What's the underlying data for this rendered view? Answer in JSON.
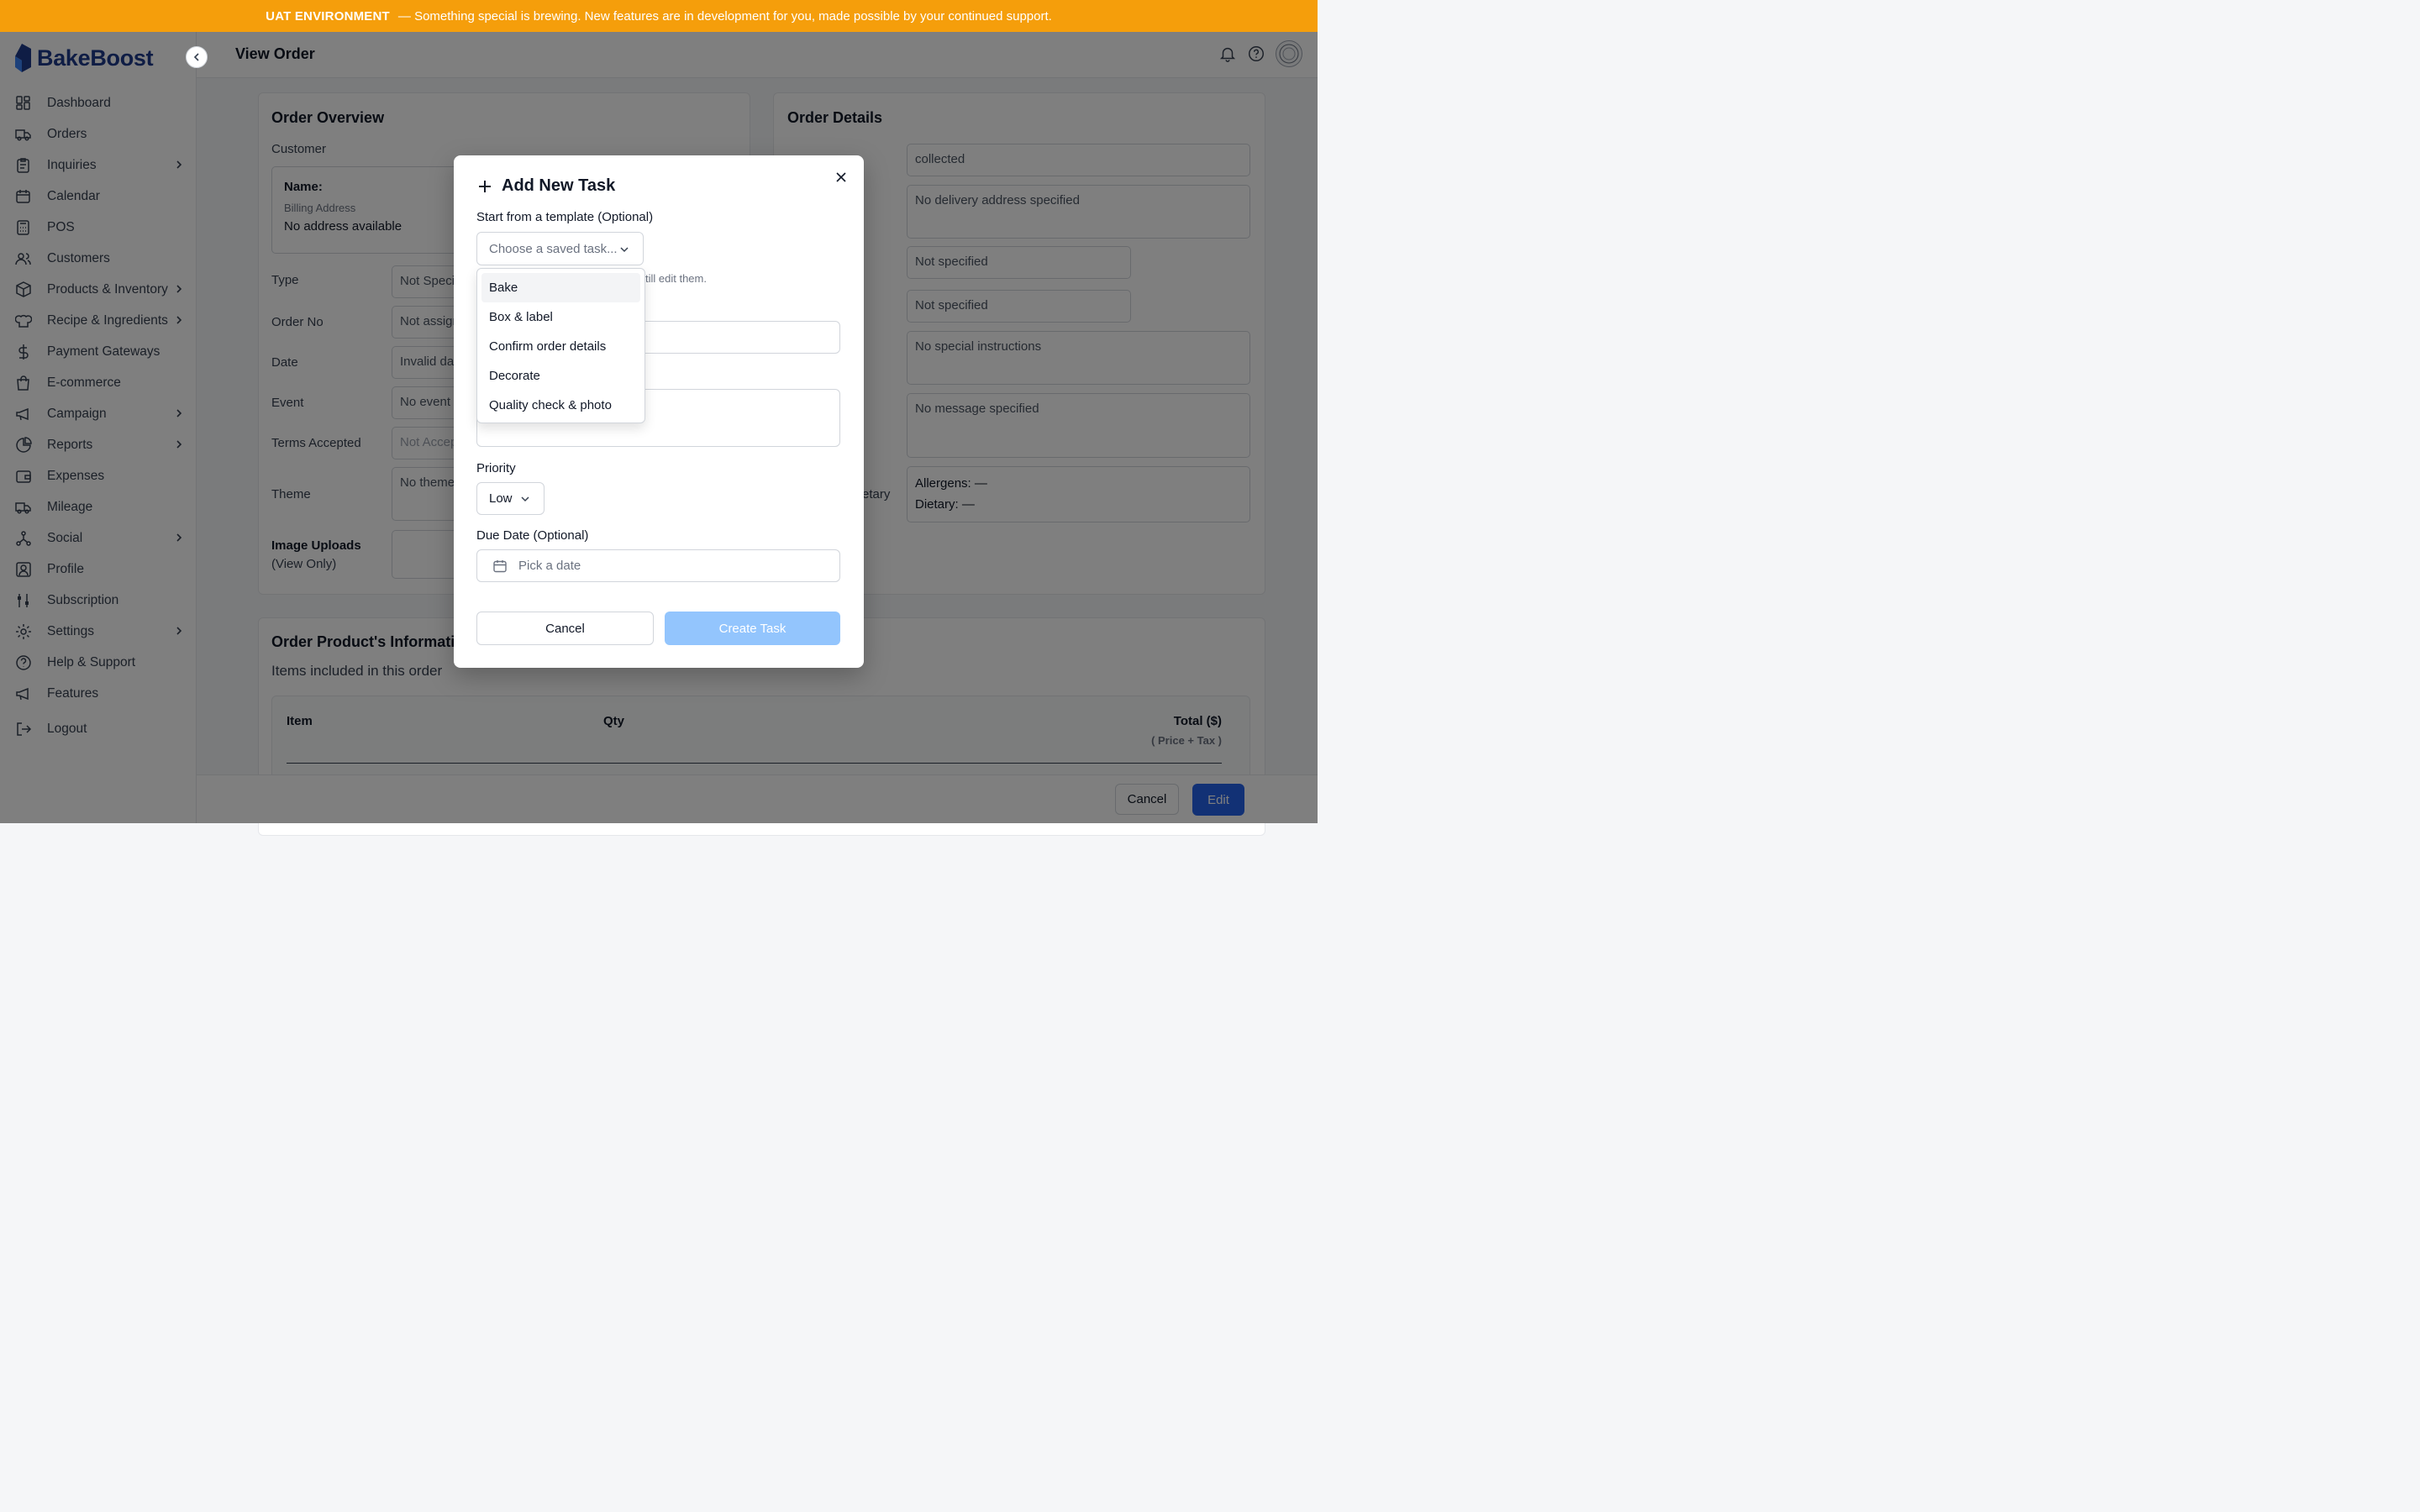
{
  "banner": {
    "env": "UAT ENVIRONMENT",
    "message": "— Something special is brewing. New features are in development for you, made possible by your continued support."
  },
  "brand": {
    "name": "BakeBoost"
  },
  "sidebar": {
    "items": [
      {
        "label": "Dashboard",
        "icon": "dashboard-icon"
      },
      {
        "label": "Orders",
        "icon": "truck-icon"
      },
      {
        "label": "Inquiries",
        "icon": "clipboard-icon",
        "has_children": true
      },
      {
        "label": "Calendar",
        "icon": "calendar-icon"
      },
      {
        "label": "POS",
        "icon": "calculator-icon"
      },
      {
        "label": "Customers",
        "icon": "users-icon"
      },
      {
        "label": "Products & Inventory",
        "icon": "box-icon",
        "has_children": true
      },
      {
        "label": "Recipe & Ingredients",
        "icon": "chef-hat-icon",
        "has_children": true
      },
      {
        "label": "Payment Gateways",
        "icon": "dollar-icon"
      },
      {
        "label": "E-commerce",
        "icon": "shopping-bag-icon"
      },
      {
        "label": "Campaign",
        "icon": "megaphone-icon",
        "has_children": true
      },
      {
        "label": "Reports",
        "icon": "pie-chart-icon",
        "has_children": true
      },
      {
        "label": "Expenses",
        "icon": "wallet-icon"
      },
      {
        "label": "Mileage",
        "icon": "truck-icon"
      },
      {
        "label": "Social",
        "icon": "share-icon",
        "has_children": true
      },
      {
        "label": "Profile",
        "icon": "user-square-icon"
      },
      {
        "label": "Subscription",
        "icon": "sliders-icon"
      },
      {
        "label": "Settings",
        "icon": "gear-icon",
        "has_children": true
      },
      {
        "label": "Help & Support",
        "icon": "help-circle-icon"
      },
      {
        "label": "Features",
        "icon": "megaphone-icon"
      },
      {
        "label": "Logout",
        "icon": "logout-icon"
      }
    ]
  },
  "header": {
    "title": "View Order"
  },
  "overview": {
    "title": "Order Overview",
    "customer_label": "Customer",
    "name_label": "Name:",
    "billing_label": "Billing Address",
    "billing_value": "No address available",
    "type_label": "Type",
    "type_value": "Not Speci",
    "order_no_label": "Order No",
    "order_no_value": "Not assign",
    "date_label": "Date",
    "date_value": "Invalid dat",
    "event_label": "Event",
    "event_value": "No event s",
    "terms_label": "Terms Accepted",
    "terms_value": "Not Accep",
    "theme_label": "Theme",
    "theme_value": "No theme",
    "images_label": "Image Uploads",
    "images_sub": "(View Only)"
  },
  "details": {
    "title": "Order Details",
    "status_value": "collected",
    "delivery_value": "No delivery address specified",
    "field3_value": "Not specified",
    "field4_value": "Not specified",
    "instructions_value": "No special instructions",
    "message_value": "No message specified",
    "dietary_label_partial": "etary",
    "allergens": "Allergens: —",
    "dietary": "Dietary: —"
  },
  "products": {
    "title": "Order Product's Informatior",
    "subtitle": "Items included in this order",
    "col_item": "Item",
    "col_qty": "Qty",
    "col_total": "Total ($)",
    "col_total_sub": "( Price + Tax )"
  },
  "footer": {
    "cancel": "Cancel",
    "edit": "Edit"
  },
  "modal": {
    "title": "Add New Task",
    "template_label": "Start from a template (Optional)",
    "template_placeholder": "Choose a saved task...",
    "hint_partial": "till edit them.",
    "priority_label": "Priority",
    "priority_value": "Low",
    "due_label": "Due Date (Optional)",
    "due_placeholder": "Pick a date",
    "cancel": "Cancel",
    "create": "Create Task",
    "templates": [
      "Bake",
      "Box & label",
      "Confirm order details",
      "Decorate",
      "Quality check & photo"
    ]
  },
  "colors": {
    "banner": "#f59e0b",
    "brand": "#1e3a8a",
    "primary": "#2563eb",
    "primary_disabled": "#93c5fd"
  }
}
